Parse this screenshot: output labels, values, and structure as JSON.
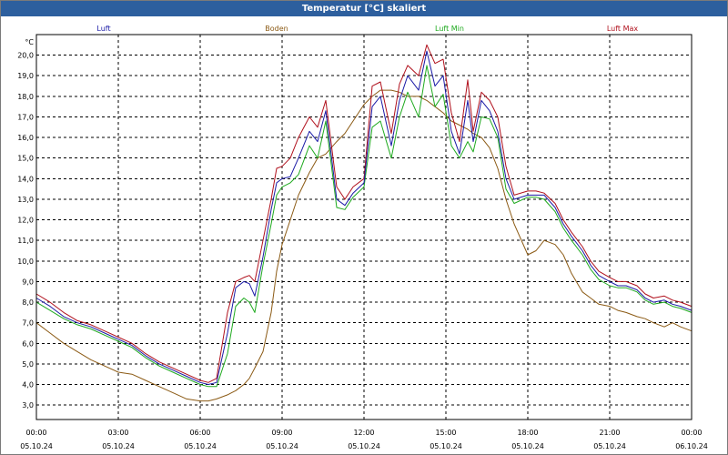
{
  "window": {
    "title": "Temperatur [°C] skaliert"
  },
  "colors": {
    "luft": "#1a1aa6",
    "boden": "#8b5a14",
    "luft_min": "#1faa1f",
    "luft_max": "#b0101c"
  },
  "chart_data": {
    "type": "line",
    "title": "Temperatur [°C] skaliert",
    "ylabel": "°C",
    "xlabel": "",
    "ylim": [
      2.3,
      21.0
    ],
    "xlim": [
      "2024-10-05T00:00",
      "2024-10-06T00:00"
    ],
    "grid": true,
    "legend_position": "top",
    "y_ticks": [
      "3,0",
      "4,0",
      "5,0",
      "6,0",
      "7,0",
      "8,0",
      "9,0",
      "10,0",
      "11,0",
      "12,0",
      "13,0",
      "14,0",
      "15,0",
      "16,0",
      "17,0",
      "18,0",
      "19,0",
      "20,0"
    ],
    "x_ticks": [
      {
        "time": "00:00",
        "date": "05.10.24"
      },
      {
        "time": "03:00",
        "date": "05.10.24"
      },
      {
        "time": "06:00",
        "date": "05.10.24"
      },
      {
        "time": "09:00",
        "date": "05.10.24"
      },
      {
        "time": "12:00",
        "date": "05.10.24"
      },
      {
        "time": "15:00",
        "date": "05.10.24"
      },
      {
        "time": "18:00",
        "date": "05.10.24"
      },
      {
        "time": "21:00",
        "date": "05.10.24"
      },
      {
        "time": "00:00",
        "date": "06.10.24"
      }
    ],
    "x_hours": [
      0,
      0.5,
      1,
      1.5,
      2,
      2.5,
      3,
      3.5,
      4,
      4.5,
      5,
      5.5,
      6,
      6.3,
      6.6,
      7,
      7.3,
      7.6,
      7.8,
      8,
      8.3,
      8.6,
      8.8,
      9,
      9.3,
      9.6,
      10,
      10.3,
      10.6,
      11,
      11.3,
      11.6,
      12,
      12.3,
      12.6,
      13,
      13.3,
      13.6,
      14,
      14.3,
      14.6,
      14.9,
      15.2,
      15.5,
      15.8,
      16,
      16.3,
      16.6,
      16.9,
      17.2,
      17.5,
      18,
      18.3,
      18.6,
      19,
      19.3,
      19.6,
      20,
      20.3,
      20.6,
      21,
      21.3,
      21.6,
      22,
      22.3,
      22.6,
      23,
      23.3,
      23.6,
      24
    ],
    "series": [
      {
        "name": "Luft",
        "color_key": "luft",
        "values": [
          8.2,
          7.8,
          7.3,
          7.0,
          6.8,
          6.5,
          6.2,
          5.9,
          5.4,
          5.0,
          4.7,
          4.4,
          4.1,
          4.0,
          4.1,
          6.5,
          8.7,
          9.0,
          8.9,
          8.3,
          10.2,
          12.5,
          13.8,
          14.0,
          14.1,
          15.0,
          16.3,
          15.8,
          17.3,
          13.0,
          12.7,
          13.3,
          13.8,
          17.5,
          18.0,
          15.6,
          17.8,
          19.0,
          18.3,
          20.2,
          18.5,
          19.0,
          16.3,
          15.2,
          17.8,
          15.8,
          17.8,
          17.3,
          16.3,
          14.0,
          13.0,
          13.2,
          13.2,
          13.2,
          12.6,
          11.8,
          11.2,
          10.5,
          9.8,
          9.3,
          9.0,
          8.8,
          8.8,
          8.6,
          8.2,
          8.0,
          8.1,
          7.9,
          7.8,
          7.6
        ]
      },
      {
        "name": "Boden",
        "color_key": "boden",
        "values": [
          7.0,
          6.5,
          6.0,
          5.6,
          5.2,
          4.9,
          4.6,
          4.5,
          4.2,
          3.9,
          3.6,
          3.3,
          3.2,
          3.2,
          3.3,
          3.5,
          3.7,
          4.0,
          4.3,
          4.8,
          5.6,
          7.5,
          9.5,
          10.8,
          12.0,
          13.2,
          14.3,
          15.0,
          15.2,
          15.8,
          16.2,
          16.8,
          17.6,
          18.0,
          18.3,
          18.3,
          18.2,
          18.0,
          18.0,
          17.8,
          17.5,
          17.2,
          16.8,
          16.6,
          16.4,
          16.2,
          16.0,
          15.5,
          14.5,
          13.0,
          11.8,
          10.3,
          10.5,
          11.0,
          10.8,
          10.3,
          9.4,
          8.5,
          8.2,
          7.9,
          7.8,
          7.6,
          7.5,
          7.3,
          7.2,
          7.0,
          6.8,
          7.0,
          6.8,
          6.6
        ]
      },
      {
        "name": "Luft Min",
        "color_key": "luft_min",
        "values": [
          8.0,
          7.6,
          7.2,
          6.9,
          6.7,
          6.4,
          6.1,
          5.8,
          5.3,
          4.9,
          4.6,
          4.3,
          4.0,
          3.9,
          3.9,
          5.5,
          7.8,
          8.2,
          8.0,
          7.5,
          9.8,
          11.8,
          13.2,
          13.6,
          13.8,
          14.2,
          15.6,
          15.0,
          16.8,
          12.6,
          12.5,
          13.1,
          13.6,
          16.5,
          16.8,
          15.0,
          17.0,
          18.2,
          17.0,
          19.5,
          17.5,
          18.1,
          15.6,
          15.0,
          15.8,
          15.3,
          17.0,
          16.9,
          16.0,
          13.5,
          12.8,
          13.1,
          13.1,
          13.0,
          12.4,
          11.6,
          11.0,
          10.3,
          9.6,
          9.1,
          8.8,
          8.7,
          8.7,
          8.5,
          8.1,
          7.9,
          8.0,
          7.8,
          7.7,
          7.5
        ]
      },
      {
        "name": "Luft Max",
        "color_key": "luft_max",
        "values": [
          8.4,
          8.0,
          7.5,
          7.1,
          6.9,
          6.6,
          6.3,
          6.0,
          5.5,
          5.1,
          4.8,
          4.5,
          4.2,
          4.1,
          4.3,
          7.5,
          9.0,
          9.2,
          9.3,
          9.0,
          11.0,
          13.0,
          14.5,
          14.6,
          15.0,
          16.0,
          17.0,
          16.5,
          17.8,
          13.6,
          13.0,
          13.6,
          14.0,
          18.5,
          18.7,
          16.2,
          18.6,
          19.5,
          19.0,
          20.5,
          19.6,
          19.8,
          17.2,
          15.8,
          18.8,
          16.3,
          18.2,
          17.8,
          17.0,
          14.6,
          13.2,
          13.4,
          13.4,
          13.3,
          12.8,
          12.0,
          11.4,
          10.7,
          10.0,
          9.5,
          9.2,
          9.0,
          9.0,
          8.8,
          8.4,
          8.2,
          8.3,
          8.1,
          8.0,
          7.8
        ]
      }
    ]
  }
}
